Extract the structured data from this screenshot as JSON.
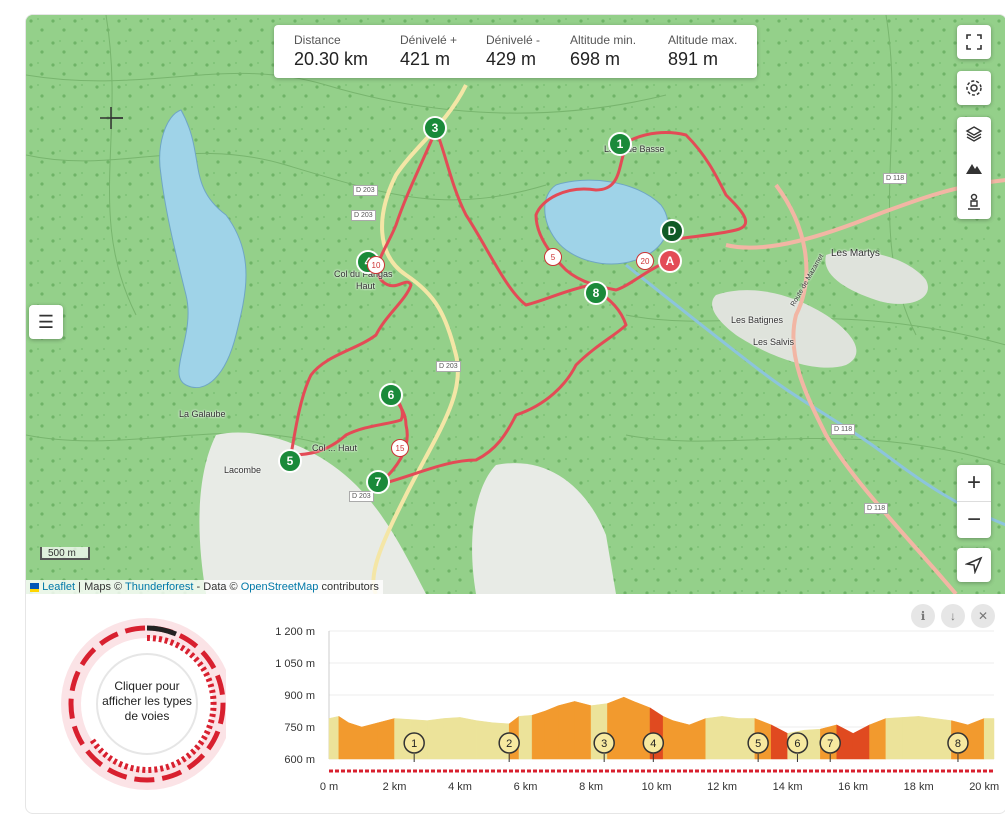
{
  "stats": [
    {
      "label": "Distance",
      "value": "20.30 km"
    },
    {
      "label": "Dénivelé +",
      "value": "421 m"
    },
    {
      "label": "Dénivelé -",
      "value": "429 m"
    },
    {
      "label": "Altitude min.",
      "value": "698 m"
    },
    {
      "label": "Altitude max.",
      "value": "891 m"
    }
  ],
  "map": {
    "scale_label": "500 m",
    "attribution": {
      "leaflet": "Leaflet",
      "maps": "| Maps ©",
      "thunderforest": "Thunderforest",
      "data": "- Data ©",
      "osm": "OpenStreetMap",
      "contributors": "contributors"
    },
    "places": {
      "lapra": "Laprade Basse",
      "col_fangas": "Col du Fangas",
      "haut": "Haut",
      "la_galaube": "La Galaube",
      "lacombe": "Lacombe",
      "col_haut": "Col ... Haut",
      "les_martys": "Les Martys",
      "les_batignes": "Les Batignes",
      "les_salvis": "Les Salvis",
      "route": "Route de Mazamet"
    },
    "roads": {
      "d203a": "D 203",
      "d203b": "D 203",
      "d203c": "D 203",
      "d203d": "D 203",
      "d118a": "D 118",
      "d118b": "D 118",
      "d118c": "D 118"
    },
    "waypoints": [
      "1",
      "3",
      "4",
      "5",
      "6",
      "7",
      "8"
    ],
    "start_label": "D",
    "end_label": "A",
    "km_markers": [
      "5",
      "10",
      "15",
      "20"
    ],
    "icons": [
      "fullscreen-icon",
      "settings-icon",
      "layers-icon",
      "mountain-icon",
      "pegman-icon",
      "zoom-in-icon",
      "zoom-out-icon",
      "locate-icon",
      "menu-icon"
    ]
  },
  "donut": {
    "label": "Cliquer pour afficher les types de voies"
  },
  "chart_data": {
    "type": "area",
    "title": "",
    "xlabel": "",
    "ylabel": "",
    "xlim": [
      0,
      20.3
    ],
    "ylim": [
      600,
      1200
    ],
    "y_ticks": [
      "1 200 m",
      "1 050 m",
      "900 m",
      "750 m",
      "600 m"
    ],
    "x_ticks": [
      "0 m",
      "2 km",
      "4 km",
      "6 km",
      "8 km",
      "10 km",
      "12 km",
      "14 km",
      "16 km",
      "18 km",
      "20 km"
    ],
    "x": [
      0,
      0.3,
      0.6,
      1.0,
      1.5,
      2.0,
      2.5,
      3.0,
      3.5,
      4.0,
      4.5,
      5.0,
      5.5,
      5.8,
      6.2,
      6.6,
      7.0,
      7.5,
      8.0,
      8.5,
      9.0,
      9.3,
      9.8,
      10.2,
      10.5,
      11.0,
      11.5,
      12.0,
      12.5,
      13.0,
      13.5,
      14.0,
      14.5,
      15.0,
      15.5,
      16.0,
      16.5,
      17.0,
      17.5,
      18.0,
      18.5,
      19.0,
      19.5,
      20.0,
      20.3
    ],
    "y": [
      790,
      800,
      770,
      750,
      770,
      790,
      785,
      780,
      790,
      795,
      780,
      770,
      765,
      800,
      805,
      825,
      850,
      870,
      850,
      860,
      890,
      870,
      840,
      800,
      780,
      760,
      790,
      800,
      790,
      790,
      760,
      720,
      735,
      740,
      760,
      720,
      760,
      790,
      795,
      800,
      790,
      780,
      760,
      790,
      790
    ],
    "waypoints": [
      {
        "label": "1",
        "x": 2.6
      },
      {
        "label": "2",
        "x": 5.5
      },
      {
        "label": "3",
        "x": 8.4
      },
      {
        "label": "4",
        "x": 9.9
      },
      {
        "label": "5",
        "x": 13.1
      },
      {
        "label": "6",
        "x": 14.3
      },
      {
        "label": "7",
        "x": 15.3
      },
      {
        "label": "8",
        "x": 19.2
      }
    ],
    "grid": true
  }
}
